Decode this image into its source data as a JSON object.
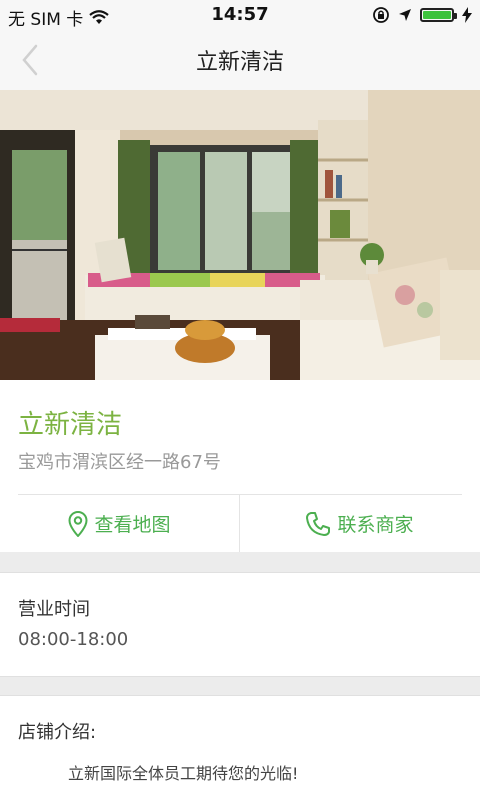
{
  "status_bar": {
    "carrier": "无 SIM 卡",
    "time": "14:57",
    "battery_level": 1.0
  },
  "nav": {
    "title": "立新清洁",
    "back_icon": "chevron-left-icon"
  },
  "shop": {
    "name": "立新清洁",
    "address": "宝鸡市渭滨区经一路67号"
  },
  "actions": {
    "map_label": "查看地图",
    "map_icon": "map-pin-icon",
    "call_label": "联系商家",
    "call_icon": "phone-icon"
  },
  "hours": {
    "label": "营业时间",
    "value": "08:00-18:00"
  },
  "intro": {
    "label": "店铺介绍:",
    "text": "立新国际全体员工期待您的光临!"
  },
  "colors": {
    "accent": "#4caf50",
    "title_green": "#7cb342",
    "battery": "#3cc23c"
  }
}
